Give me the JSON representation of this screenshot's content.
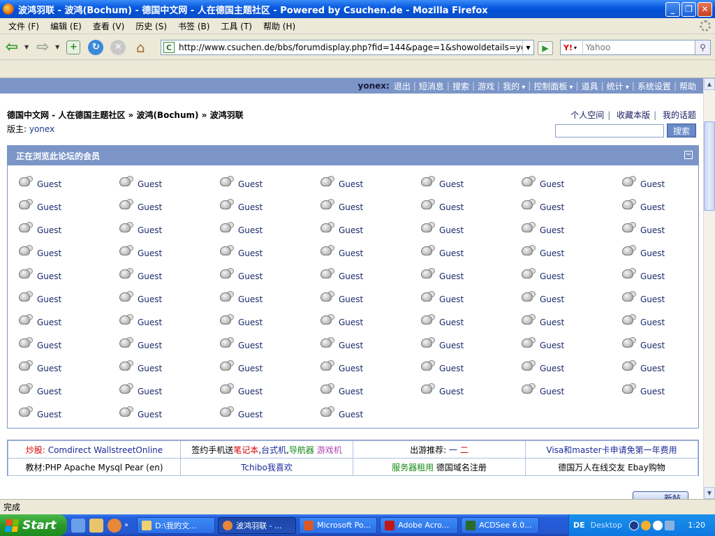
{
  "window": {
    "title": "波鸿羽联 - 波鸿(Bochum) - 德国中文网 - 人在德国主题社区 - Powered by Csuchen.de - Mozilla Firefox"
  },
  "menu": [
    "文件 (F)",
    "编辑 (E)",
    "查看 (V)",
    "历史 (S)",
    "书签 (B)",
    "工具 (T)",
    "帮助 (H)"
  ],
  "address": {
    "url": "http://www.csuchen.de/bbs/forumdisplay.php?fid=144&page=1&showoldetails=yes#onli",
    "search_engine": "Y!",
    "search_placeholder": "Yahoo"
  },
  "topnav": {
    "username": "yonex:",
    "links": [
      "退出",
      "短消息",
      "搜索",
      "游戏",
      "我的",
      "控制面板",
      "道具",
      "统计",
      "系统设置",
      "帮助"
    ]
  },
  "breadcrumb": "德国中文网 - 人在德国主题社区 » 波鸿(Bochum) » 波鸿羽联",
  "moderator": {
    "label": "版主: ",
    "name": "yonex"
  },
  "quicklinks": [
    "个人空间",
    "收藏本版",
    "我的话题"
  ],
  "search_button": "搜索",
  "online_panel": {
    "title": "正在浏览此论坛的会员",
    "guest_label": "Guest",
    "guest_count": 74
  },
  "ads": {
    "row1": {
      "c1_a": "炒股: ",
      "c1_b": "Comdirect WallstreetOnline",
      "c2_a": "签约手机送",
      "c2_b": "笔记本",
      "c2_c": ",",
      "c2_d": "台式机",
      "c2_e": ",",
      "c2_f": "导航器",
      "c2_g": " 游戏机",
      "c3_a": "出游推荐: ",
      "c3_b": " 一 ",
      "c3_c": "二",
      "c4": "Visa和master卡申请免第一年费用"
    },
    "row2": {
      "c1": "教材:PHP Apache Mysql Pear (en)",
      "c2": "Tchibo我喜欢",
      "c3_a": "服务器租用",
      "c3_b": " 德国域名注册",
      "c4": "德国万人在线交友 Ebay购物"
    }
  },
  "new_post": "新帖",
  "status": "完成",
  "taskbar": {
    "start": "Start",
    "items": [
      "D:\\我的文...",
      "波鸿羽联 - ...",
      "Microsoft Po...",
      "Adobe Acro...",
      "ACDSee 6.0..."
    ],
    "lang": "DE",
    "desktop": "Desktop",
    "clock": "1:20"
  },
  "colors": {
    "header_blue": "#7b95c8",
    "link": "#1a2a6a"
  }
}
